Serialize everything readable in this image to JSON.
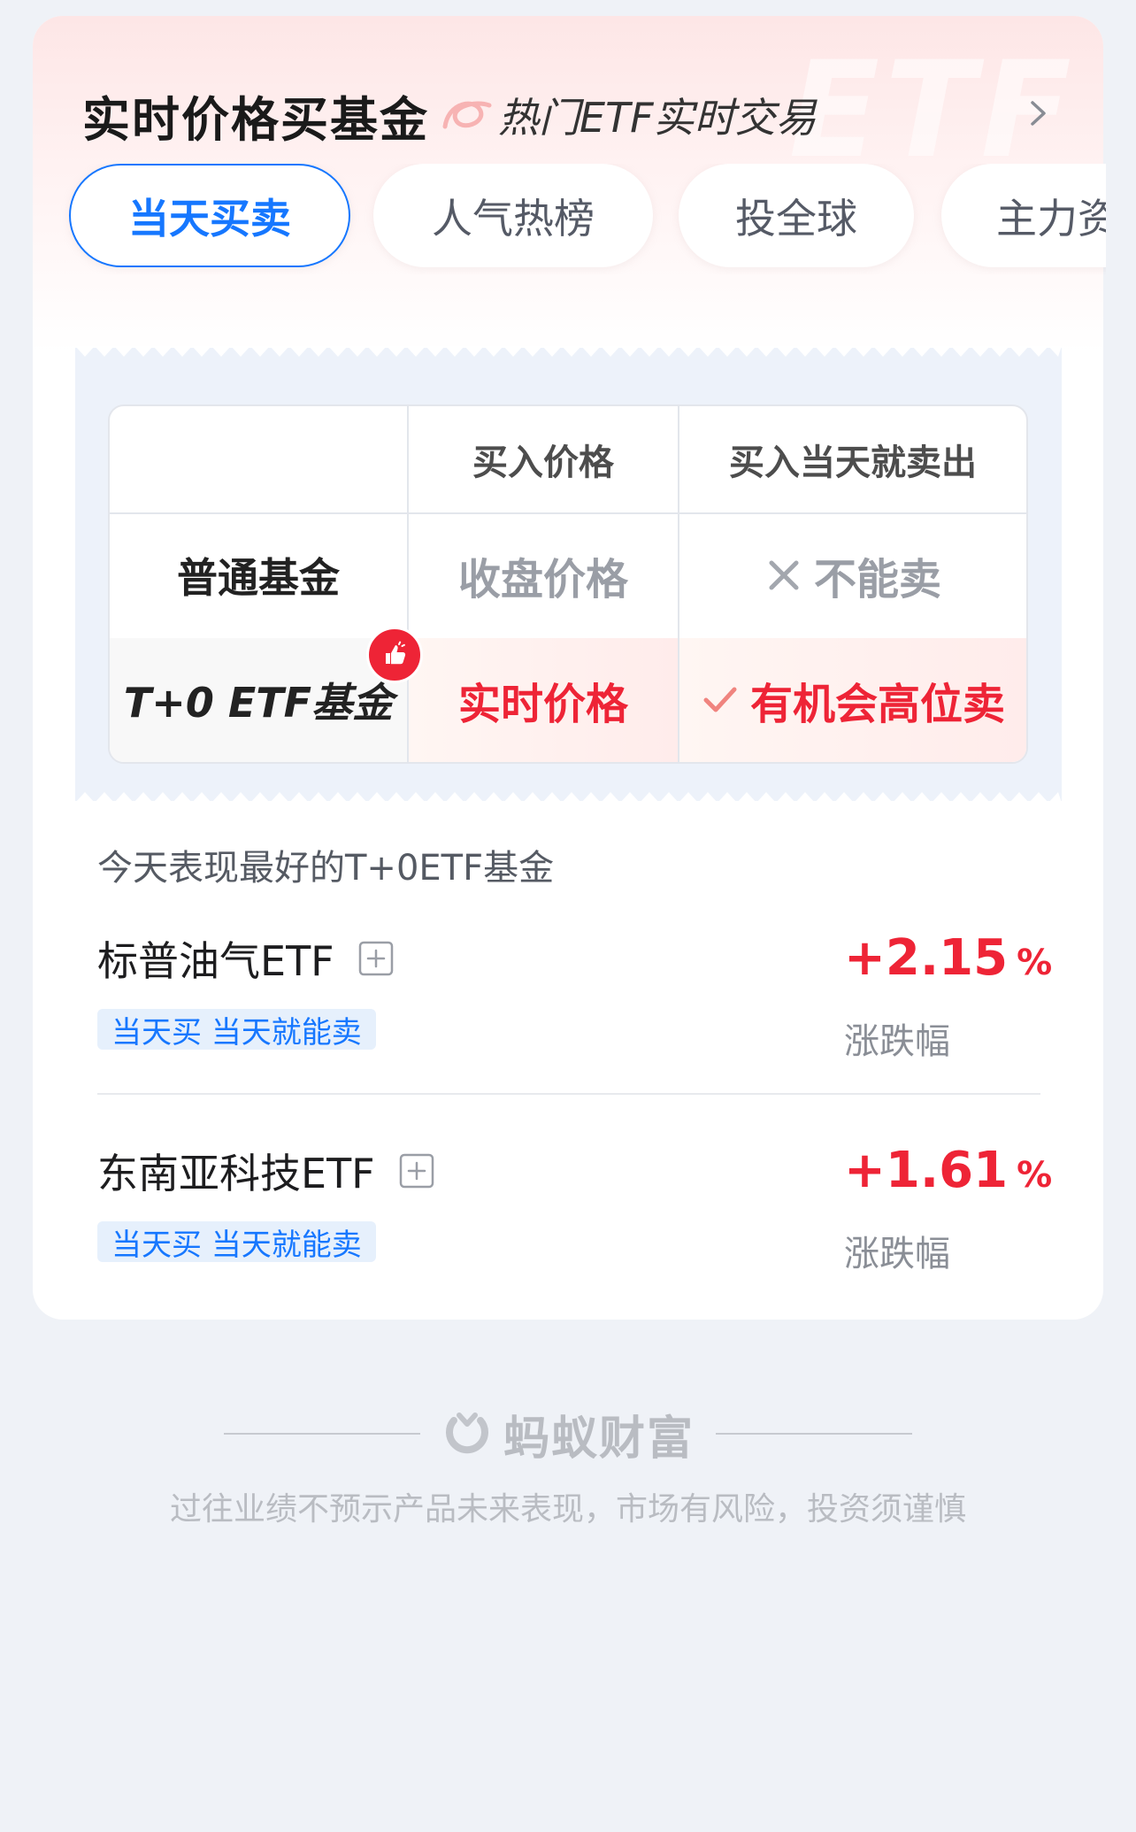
{
  "card": {
    "title": "实时价格买基金",
    "subtitle": "热门ETF实时交易",
    "watermark": "ETF"
  },
  "tabs": [
    {
      "label": "当天买卖",
      "active": true
    },
    {
      "label": "人气热榜",
      "active": false
    },
    {
      "label": "投全球",
      "active": false
    },
    {
      "label": "主力资",
      "active": false
    }
  ],
  "comparison": {
    "headers": [
      "",
      "买入价格",
      "买入当天就卖出"
    ],
    "rows": [
      {
        "label": "普通基金",
        "price": "收盘价格",
        "sell": "不能卖",
        "sell_icon": "x-icon"
      },
      {
        "label": "T+0 ETF基金",
        "price": "实时价格",
        "sell": "有机会高位卖",
        "sell_icon": "check-icon",
        "badge_icon": "thumbs-up-icon"
      }
    ]
  },
  "top_funds": {
    "section_title": "今天表现最好的T+0ETF基金",
    "items": [
      {
        "name": "标普油气ETF",
        "tag": "当天买 当天就能卖",
        "change": "+2.15",
        "unit": "%",
        "change_label": "涨跌幅"
      },
      {
        "name": "东南亚科技ETF",
        "tag": "当天买 当天就能卖",
        "change": "+1.61",
        "unit": "%",
        "change_label": "涨跌幅"
      }
    ]
  },
  "footer": {
    "brand": "蚂蚁财富",
    "disclaimer": "过往业绩不预示产品未来表现，市场有风险，投资须谨慎"
  },
  "colors": {
    "accent_blue": "#1677ff",
    "rise_red": "#ee2436",
    "background": "#eff2f7"
  }
}
